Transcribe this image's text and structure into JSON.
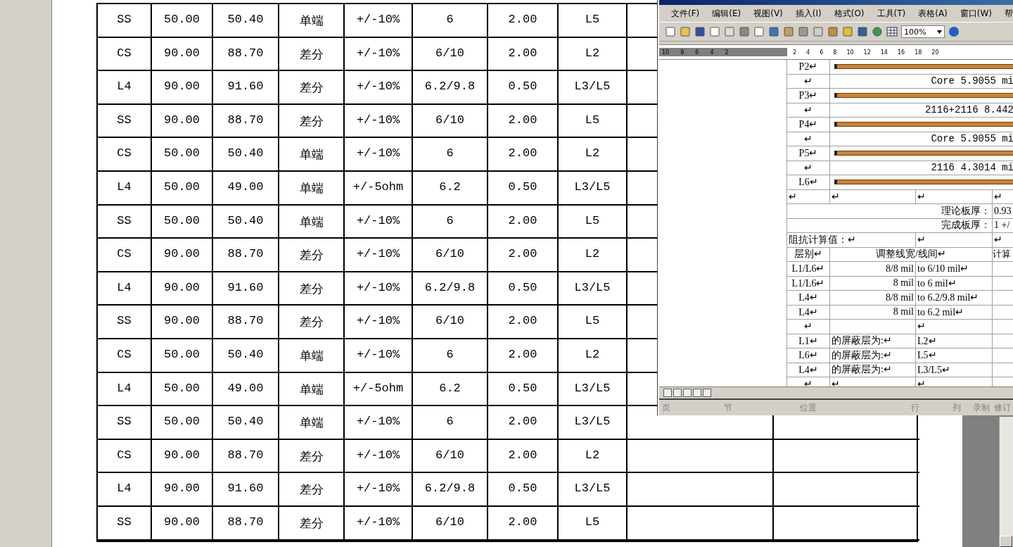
{
  "main_table": {
    "rows": [
      [
        "SS",
        "50.00",
        "50.40",
        "单端",
        "+/-10%",
        "6",
        "2.00",
        "L5"
      ],
      [
        "CS",
        "90.00",
        "88.70",
        "差分",
        "+/-10%",
        "6/10",
        "2.00",
        "L2"
      ],
      [
        "L4",
        "90.00",
        "91.60",
        "差分",
        "+/-10%",
        "6.2/9.8",
        "0.50",
        "L3/L5"
      ],
      [
        "SS",
        "90.00",
        "88.70",
        "差分",
        "+/-10%",
        "6/10",
        "2.00",
        "L5"
      ],
      [
        "CS",
        "50.00",
        "50.40",
        "单端",
        "+/-10%",
        "6",
        "2.00",
        "L2"
      ],
      [
        "L4",
        "50.00",
        "49.00",
        "单端",
        "+/-5ohm",
        "6.2",
        "0.50",
        "L3/L5"
      ],
      [
        "SS",
        "50.00",
        "50.40",
        "单端",
        "+/-10%",
        "6",
        "2.00",
        "L5"
      ],
      [
        "CS",
        "90.00",
        "88.70",
        "差分",
        "+/-10%",
        "6/10",
        "2.00",
        "L2"
      ],
      [
        "L4",
        "90.00",
        "91.60",
        "差分",
        "+/-10%",
        "6.2/9.8",
        "0.50",
        "L3/L5"
      ],
      [
        "SS",
        "90.00",
        "88.70",
        "差分",
        "+/-10%",
        "6/10",
        "2.00",
        "L5"
      ],
      [
        "CS",
        "50.00",
        "50.40",
        "单端",
        "+/-10%",
        "6",
        "2.00",
        "L2"
      ],
      [
        "L4",
        "50.00",
        "49.00",
        "单端",
        "+/-5ohm",
        "6.2",
        "0.50",
        "L3/L5"
      ],
      [
        "SS",
        "50.00",
        "50.40",
        "单端",
        "+/-10%",
        "6",
        "2.00",
        "L3/L5"
      ],
      [
        "CS",
        "90.00",
        "88.70",
        "差分",
        "+/-10%",
        "6/10",
        "2.00",
        "L2"
      ],
      [
        "L4",
        "90.00",
        "91.60",
        "差分",
        "+/-10%",
        "6.2/9.8",
        "0.50",
        "L3/L5"
      ],
      [
        "SS",
        "90.00",
        "88.70",
        "差分",
        "+/-10%",
        "6/10",
        "2.00",
        "L5"
      ]
    ]
  },
  "word_window": {
    "menu": [
      "文件(F)",
      "编辑(E)",
      "视图(V)",
      "插入(I)",
      "格式(O)",
      "工具(T)",
      "表格(A)",
      "窗口(W)",
      "帮"
    ],
    "zoom": "100%",
    "ruler": [
      "10",
      "8",
      "6",
      "4",
      "2",
      "2",
      "4",
      "6",
      "8",
      "10",
      "12",
      "14",
      "16",
      "18",
      "20"
    ],
    "stackup": [
      {
        "kind": "layer",
        "label": "P2↵"
      },
      {
        "kind": "dielectric",
        "label": "↵",
        "text": "Core   5.9055 mi"
      },
      {
        "kind": "layer",
        "label": "P3↵"
      },
      {
        "kind": "dielectric",
        "label": "↵",
        "text": "2116+2116    8.442"
      },
      {
        "kind": "layer",
        "label": "P4↵"
      },
      {
        "kind": "dielectric",
        "label": "↵",
        "text": "Core   5.9055 mi"
      },
      {
        "kind": "layer",
        "label": "P5↵"
      },
      {
        "kind": "dielectric",
        "label": "↵",
        "text": "2116    4.3014 mi"
      },
      {
        "kind": "layer",
        "label": "L6↵"
      }
    ],
    "blank_row": [
      "↵",
      "↵",
      "↵",
      "↵"
    ],
    "thickness": [
      {
        "label": "理论板厚：",
        "value": "0.93"
      },
      {
        "label": "完成板厚：",
        "value": "1 +/"
      }
    ],
    "calc_title": [
      "阻抗计算值：↵",
      "↵",
      "↵"
    ],
    "calc_header": [
      "层别↵",
      "调整线宽/线间↵",
      "计算"
    ],
    "calc_rows": [
      {
        "layer": "L1/L6↵",
        "from": "8/8 mil",
        "to": "to 6/10 mil↵"
      },
      {
        "layer": "L1/L6↵",
        "from": "8 mil",
        "to": "to 6 mil↵"
      },
      {
        "layer": "L4↵",
        "from": "8/8 mil",
        "to": "to 6.2/9.8 mil↵"
      },
      {
        "layer": "L4↵",
        "from": "8 mil",
        "to": "to 6.2 mil↵"
      },
      {
        "layer": "↵",
        "from": "",
        "to": "↵"
      }
    ],
    "shield_rows": [
      {
        "layer": "L1↵",
        "text": "的屏蔽层为:↵",
        "value": "L2↵"
      },
      {
        "layer": "L6↵",
        "text": "的屏蔽层为:↵",
        "value": "L5↵"
      },
      {
        "layer": "L4↵",
        "text": "的屏蔽层为:↵",
        "value": "L3/L5↵"
      },
      {
        "layer": "↵",
        "text": "↵",
        "value": "↵"
      }
    ],
    "status_bar": [
      "页",
      "节",
      "位置",
      "行",
      "列",
      "录制",
      "修订"
    ]
  }
}
